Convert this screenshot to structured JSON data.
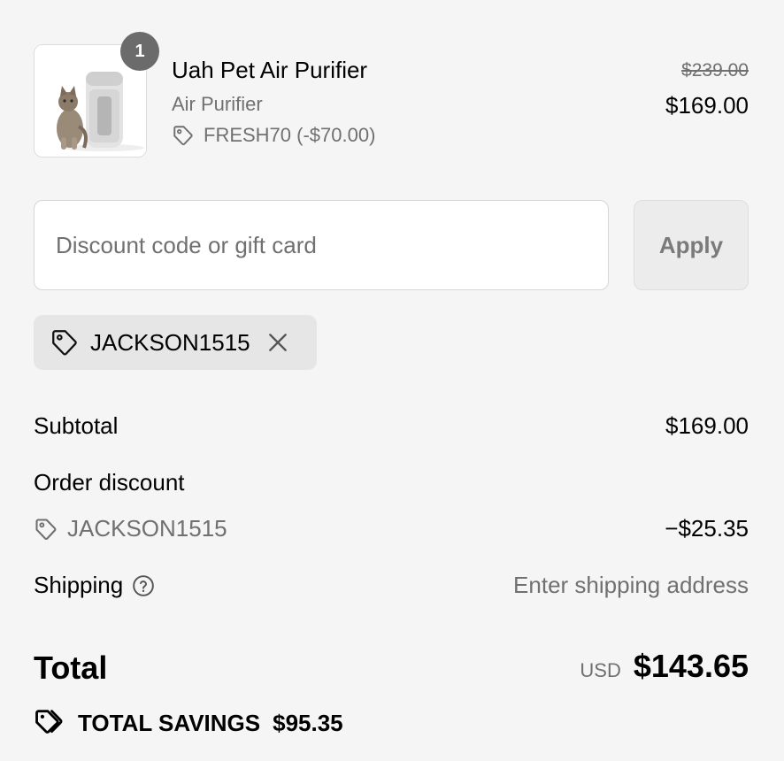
{
  "product": {
    "quantity": "1",
    "name": "Uah Pet Air Purifier",
    "variant": "Air Purifier",
    "discount_code_label": "FRESH70 (-$70.00)",
    "original_price": "$239.00",
    "price": "$169.00",
    "image_icon": "pet-air-purifier-image"
  },
  "discount": {
    "placeholder": "Discount code or gift card",
    "value": "",
    "apply_label": "Apply",
    "applied_code": "JACKSON1515"
  },
  "summary": {
    "subtotal_label": "Subtotal",
    "subtotal_value": "$169.00",
    "order_discount_label": "Order discount",
    "order_discount_code": "JACKSON1515",
    "order_discount_value": "−$25.35",
    "shipping_label": "Shipping",
    "shipping_value": "Enter shipping address",
    "total_label": "Total",
    "currency": "USD",
    "total_value": "$143.65",
    "savings_label": "TOTAL SAVINGS",
    "savings_value": "$95.35"
  },
  "colors": {
    "background": "#f5f5f5",
    "muted_text": "#707070",
    "badge": "#6b6b6b",
    "chip": "#e6e6e6"
  }
}
